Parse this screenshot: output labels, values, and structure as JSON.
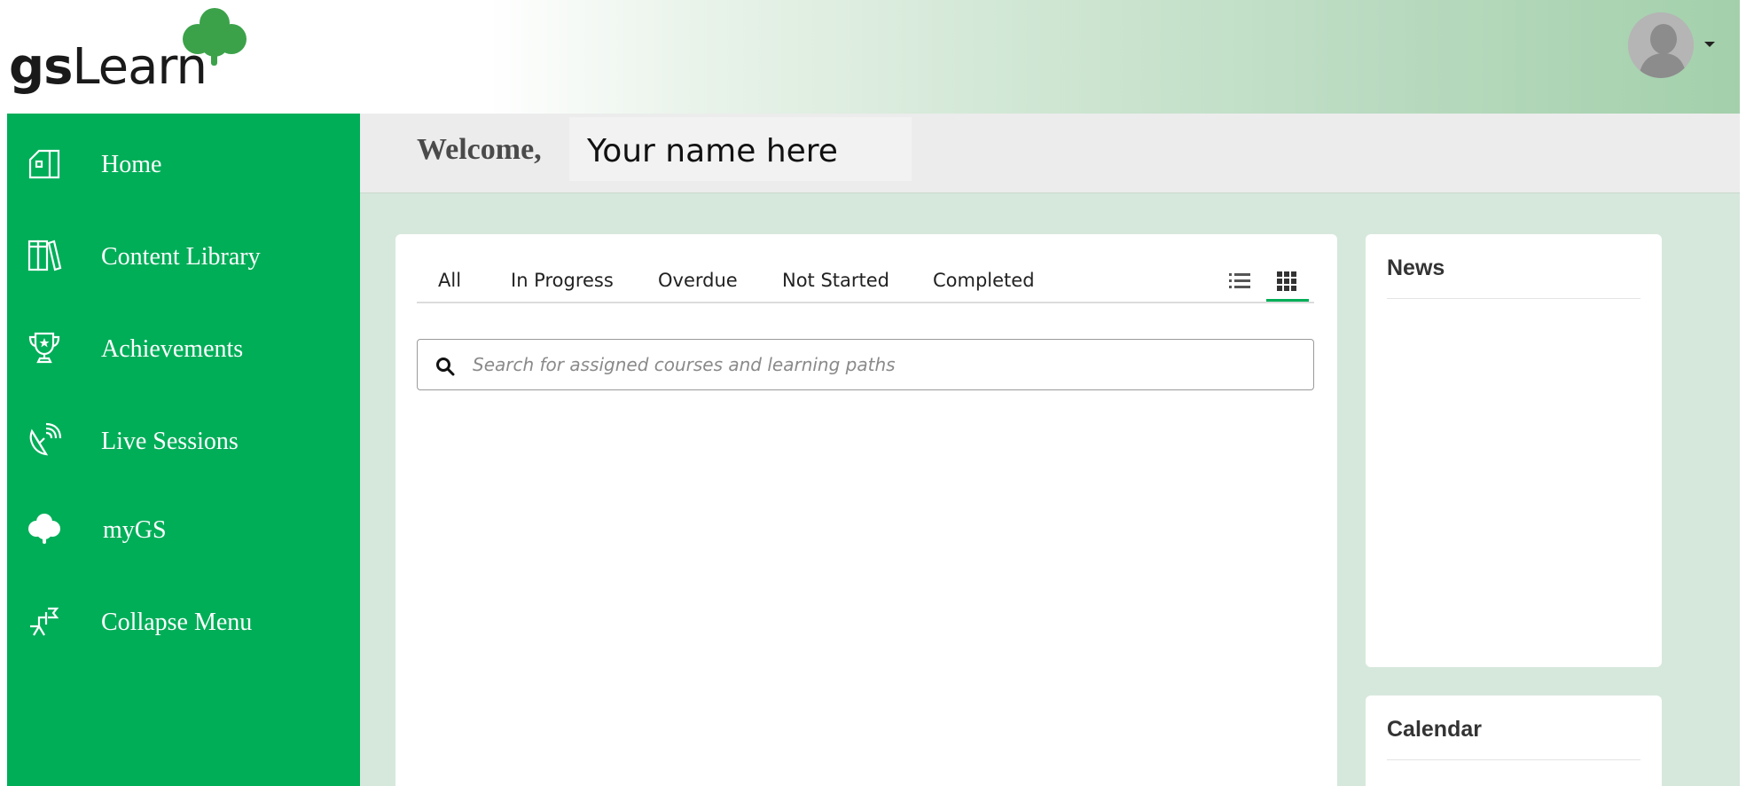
{
  "header": {
    "logo_bold": "gs",
    "logo_light": "Learn",
    "avatar_icon": "user-avatar-icon",
    "caret_icon": "caret-down-icon"
  },
  "sidebar": {
    "items": [
      {
        "label": "Home",
        "icon": "home-icon"
      },
      {
        "label": "Content Library",
        "icon": "library-icon"
      },
      {
        "label": "Achievements",
        "icon": "trophy-icon"
      },
      {
        "label": "Live Sessions",
        "icon": "satellite-dish-icon"
      },
      {
        "label": "myGS",
        "icon": "clover-icon"
      },
      {
        "label": "Collapse Menu",
        "icon": "collapse-arrow-icon"
      }
    ]
  },
  "welcome": {
    "greeting": "Welcome,",
    "name": "Your name here"
  },
  "assignments": {
    "tabs": [
      "All",
      "In Progress",
      "Overdue",
      "Not Started",
      "Completed"
    ],
    "view_list_icon": "list-view-icon",
    "view_grid_icon": "grid-view-icon",
    "active_view": "grid",
    "search_placeholder": "Search for assigned courses and learning paths"
  },
  "side_cards": {
    "news_title": "News",
    "calendar_title": "Calendar"
  },
  "colors": {
    "brand_green": "#00ae58",
    "clover_green": "#3ca24a",
    "main_bg": "#d6e8dc"
  }
}
